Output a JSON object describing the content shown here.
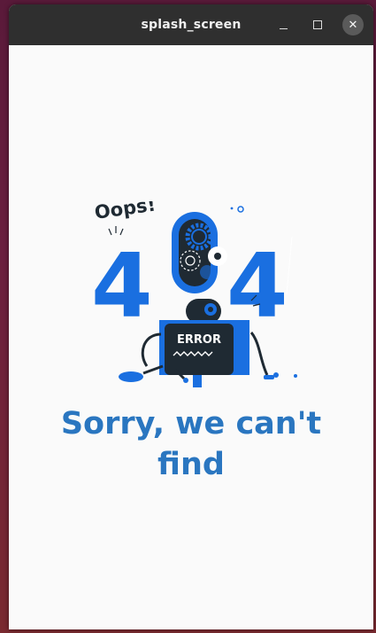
{
  "window": {
    "title": "splash_screen"
  },
  "illustration": {
    "oops_text": "Oops!",
    "digit_left": "4",
    "digit_right": "4",
    "error_label": "ERROR"
  },
  "message": {
    "line1": "Sorry, we can't",
    "line2": "find"
  },
  "colors": {
    "accent": "#1a6fe0",
    "message_text": "#2a76c0",
    "titlebar": "#2f2f2f",
    "dark": "#1f2a33"
  }
}
